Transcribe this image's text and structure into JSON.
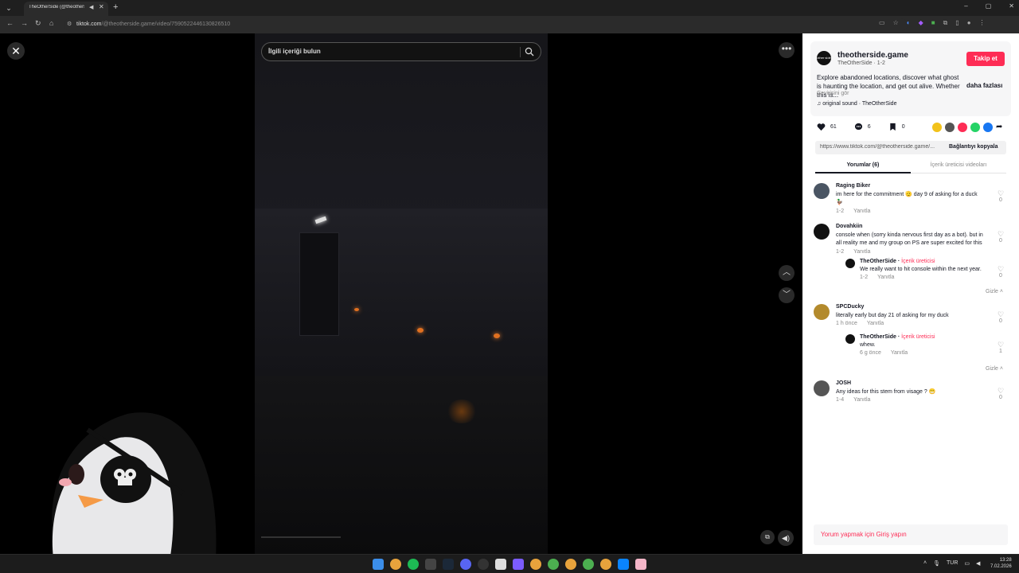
{
  "browser": {
    "tab_title": "TheOtherSide (@theotherside",
    "url_domain": "tiktok.com",
    "url_path": "/@theotherside.game/video/7590522446130826510"
  },
  "video": {
    "search_placeholder": "İlgili içeriği bulun"
  },
  "post": {
    "author_name": "theotherside.game",
    "author_sub": "TheOtherSide · 1-2",
    "author_avatar_text": "other side",
    "follow_label": "Takip et",
    "description": "Explore abandoned locations, discover what ghost is haunting the location, and get out alive. Whether this is...",
    "more_label": "daha fazlası",
    "translate_label": "Çevirisini gör",
    "sound": "original sound · TheOtherSide",
    "likes": "61",
    "comments": "6",
    "saves": "0",
    "link_url": "https://www.tiktok.com/@theotherside.game/...",
    "copy_label": "Bağlantıyı kopyala"
  },
  "tabs": {
    "comments_label": "Yorumlar (6)",
    "creator_label": "İçerik üreticisi videoları"
  },
  "comments": [
    {
      "name": "Raging Biker",
      "text": "im here for the commitment 🫡 day 9 of asking for a duck 🦆",
      "time": "1-2",
      "reply": "Yanıtla",
      "likes": "0"
    },
    {
      "name": "Dovahkiin",
      "text": "console when (sorry kinda nervous first day as a bot). but in all reality me and my group on PS are super excited for this",
      "time": "1-2",
      "reply": "Yanıtla",
      "likes": "0",
      "replies": [
        {
          "name": "TheOtherSide",
          "badge": "İçerik üreticisi",
          "text": "We really want to hit console within the next year.",
          "time": "1-2",
          "reply": "Yanıtla",
          "likes": "0"
        }
      ],
      "hide_label": "Gizle"
    },
    {
      "name": "SPCDucky",
      "text": "literally early but day 21 of asking for my duck",
      "time": "1 h önce",
      "reply": "Yanıtla",
      "likes": "0",
      "replies": [
        {
          "name": "TheOtherSide",
          "badge": "İçerik üreticisi",
          "text": "whew.",
          "time": "6 g önce",
          "reply": "Yanıtla",
          "likes": "1"
        }
      ],
      "hide_label": "Gizle"
    },
    {
      "name": "JOSH",
      "text": "Any ideas for this stem from visage ? 😁",
      "time": "1-4",
      "reply": "Yanıtla",
      "likes": "0"
    }
  ],
  "login_prompt": "Yorum yapmak için Giriş yapın",
  "taskbar": {
    "lang": "TUR",
    "time": "13:28",
    "date": "7.02.2026"
  },
  "colors": {
    "accent": "#fe2c55",
    "panel_bg": "#ffffff"
  }
}
